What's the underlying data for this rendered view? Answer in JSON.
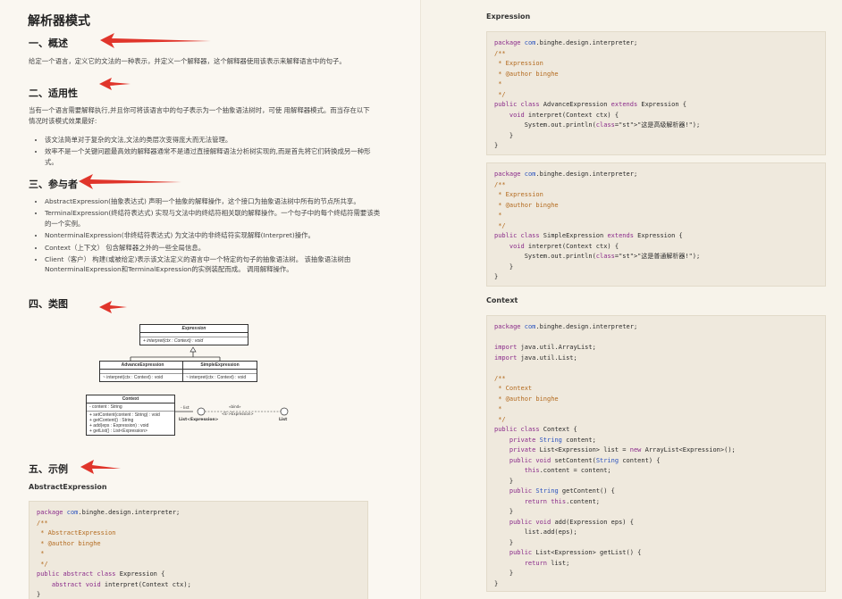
{
  "title": "解析器模式",
  "sections": {
    "overview": {
      "heading": "一、概述",
      "text": "给定一个语言，定义它的文法的一种表示，并定义一个解释器，这个解释器使用该表示来解释语言中的句子。"
    },
    "applicability": {
      "heading": "二、适用性",
      "text": "当有一个语言需要解释执行,并且你可将该语言中的句子表示为一个抽象语法树时，可使 用解释器模式。而当存在以下情况时该模式效果最好:",
      "items": [
        "该文法简单对于复杂的文法,文法的类层次变得庞大而无法管理。",
        "效率不是一个关键问题最高效的解释器通常不是通过直接解释语法分析树实现的,而是首先将它们转换成另一种形式。"
      ]
    },
    "participants": {
      "heading": "三、参与者",
      "items": [
        "AbstractExpression(抽象表达式) 声明一个抽象的解释操作，这个接口为抽象语法树中所有的节点所共享。",
        "TerminalExpression(终结符表达式) 实现与文法中的终结符相关联的解释操作。一个句子中的每个终结符需要该类的一个实例。",
        "NonterminalExpression(非终结符表达式) 为文法中的非终结符实现解释(Interpret)操作。",
        "Context（上下文） 包含解释器之外的一些全局信息。",
        "Client（客户） 构建(或被给定)表示该文法定义的语言中一个特定的句子的抽象语法树。 该抽象语法树由NonterminalExpression和TerminalExpression的实例装配而成。 调用解释操作。"
      ]
    },
    "diagram": {
      "heading": "四、类图",
      "expression_name": "Expression",
      "expression_method": "+ interpret(ctx : Context) : void",
      "advance_name": "AdvanceExpression",
      "advance_method": "~ interpret(ctx : Context) : void",
      "simple_name": "SimpleExpression",
      "simple_method": "~ interpret(ctx : Context) : void",
      "context_name": "Context",
      "context_field": "- content : String",
      "context_methods": [
        "+ setContent(content : String) : void",
        "+ getContent() : String",
        "+ add(eps : Expression) : void",
        "+ getList() : List<Expression>"
      ],
      "assoc_label": "- list",
      "list_node": "List<Expression>",
      "bind_label": "«bind»",
      "bind_param": "<E->Expression>",
      "list_generic": "List"
    },
    "example": {
      "heading": "五、示例",
      "sub_abstract": "AbstractExpression"
    }
  },
  "right": {
    "expression_heading": "Expression",
    "context_heading": "Context"
  },
  "code_abstract": [
    "package com.binghe.design.interpreter;",
    "/**",
    " * AbstractExpression",
    " * @author binghe",
    " *",
    " */",
    "public abstract class Expression {",
    "    abstract void interpret(Context ctx);",
    "}"
  ],
  "code_advance": [
    "package com.binghe.design.interpreter;",
    "/**",
    " * Expression",
    " * @author binghe",
    " *",
    " */",
    "public class AdvanceExpression extends Expression {",
    "    void interpret(Context ctx) {",
    "        System.out.println(\"这是高级解析器!\");",
    "    }",
    "}"
  ],
  "code_simple": [
    "package com.binghe.design.interpreter;",
    "/**",
    " * Expression",
    " * @author binghe",
    " *",
    " */",
    "public class SimpleExpression extends Expression {",
    "    void interpret(Context ctx) {",
    "        System.out.println(\"这是普通解析器!\");",
    "    }",
    "}"
  ],
  "code_context": [
    "package com.binghe.design.interpreter;",
    "",
    "import java.util.ArrayList;",
    "import java.util.List;",
    "",
    "/**",
    " * Context",
    " * @author binghe",
    " *",
    " */",
    "public class Context {",
    "    private String content;",
    "    private List<Expression> list = new ArrayList<Expression>();",
    "    public void setContent(String content) {",
    "        this.content = content;",
    "    }",
    "    public String getContent() {",
    "        return this.content;",
    "    }",
    "    public void add(Expression eps) {",
    "        list.add(eps);",
    "    }",
    "    public List<Expression> getList() {",
    "        return list;",
    "    }",
    "}"
  ],
  "colors": {
    "annotation_arrow": "#e0352b",
    "code_background": "#efe9dd",
    "keyword": "#8a2b8a",
    "comment": "#b36a1e",
    "class_name": "#2a52be"
  }
}
